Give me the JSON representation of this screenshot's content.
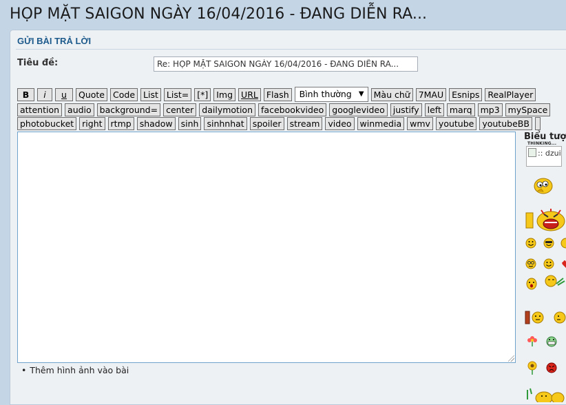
{
  "page": {
    "topic_title": "HỌP MẶT SAIGON NGÀY 16/04/2016 - ĐANG DIỄN RA..."
  },
  "reply_form": {
    "header": "GỬI BÀI TRẢ LỜI",
    "subject_label": "Tiêu đề:",
    "subject_value": "Re: HỌP MẶT SAIGON NGÀY 16/04/2016 - ĐANG DIỄN RA...",
    "add_image_label": "Thêm hình ảnh vào bài"
  },
  "toolbar": {
    "row1": [
      "B",
      "i",
      "u",
      "Quote",
      "Code",
      "List",
      "List=",
      "[*]",
      "Img",
      "URL",
      "Flash"
    ],
    "size_select": "Bình thường",
    "row1_after": [
      "Màu chữ",
      "7MAU",
      "Esnips",
      "RealPlayer"
    ],
    "row2": [
      "attention",
      "audio",
      "background=",
      "center",
      "dailymotion",
      "facebookvideo",
      "googlevideo",
      "justify",
      "left",
      "marq",
      "mp3",
      "mySpace"
    ],
    "row3": [
      "photobucket",
      "right",
      "rtmp",
      "shadow",
      "sinh",
      "sinhnhat",
      "spoiler",
      "stream",
      "video",
      "winmedia",
      "wmv",
      "youtube",
      "youtubeBB"
    ]
  },
  "smilies": {
    "heading": "Biểu tượng",
    "broken_alt": ":: dzui",
    "thinking_label": "THINKING...",
    "colors": {
      "face": "#f6c81a",
      "face_outline": "#a57a00",
      "red": "#d8261c",
      "green": "#2e9a3a",
      "flower": "#ff5a5a"
    }
  },
  "colors": {
    "page_bg": "#c4d5e6",
    "panel_bg": "#eef1f4",
    "accent": "#1d5a8c",
    "editor_border": "#6fa2cb"
  }
}
